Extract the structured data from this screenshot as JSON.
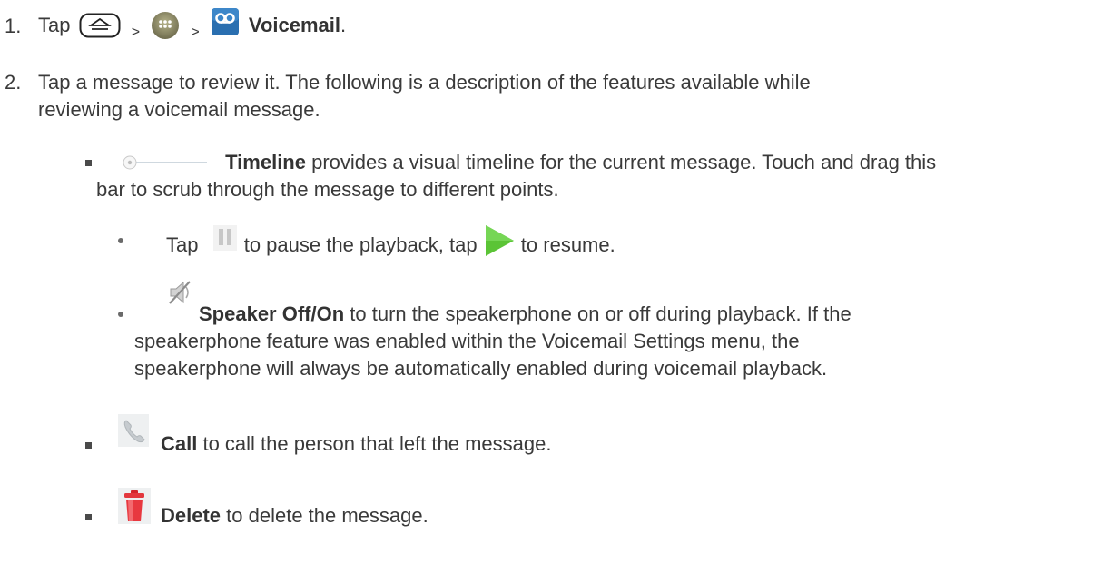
{
  "step1": {
    "number": "1.",
    "tap": "Tap",
    "sep1": ">",
    "sep2": ">",
    "voicemail": "Voicemail",
    "period": ".",
    "icons": [
      "home-key-icon",
      "apps-icon",
      "voicemail-app-icon"
    ]
  },
  "step2": {
    "number": "2.",
    "line1": "Tap a message to review it. The following is a description of the features available while",
    "line2": "reviewing a voicemail message."
  },
  "timeline": {
    "title": "Timeline",
    "rest1": " provides a visual timeline for the current message. Touch and drag this",
    "line2": "bar to scrub through the message to different points."
  },
  "playback": {
    "tap": "Tap",
    "mid": " to pause the playback, tap ",
    "end": " to resume."
  },
  "speaker": {
    "title": "Speaker Off/On",
    "rest1": " to turn the speakerphone on or off during playback. If the",
    "line2": "speakerphone feature was enabled within the Voicemail Settings menu, the",
    "line3": "speakerphone will always be automatically enabled during voicemail playback."
  },
  "call": {
    "title": "Call",
    "rest": " to call the person that left the message."
  },
  "delete": {
    "title": "Delete",
    "rest": " to delete the message."
  }
}
